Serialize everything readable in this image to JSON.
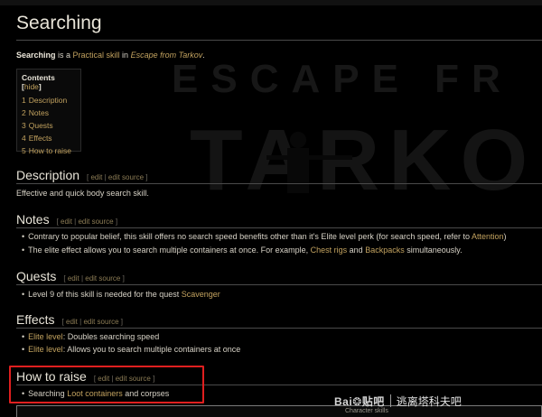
{
  "page": {
    "title": "Searching",
    "intro": {
      "bold": "Searching",
      "t1": " is a ",
      "link1": "Practical skill",
      "t2": " in ",
      "link2": "Escape from Tarkov",
      "t3": "."
    }
  },
  "background_art": {
    "line1": "ESCAPE FR",
    "line2": "TARKO"
  },
  "toc": {
    "title": "Contents",
    "hide_label": "hide",
    "items": [
      {
        "num": "1",
        "label": "Description"
      },
      {
        "num": "2",
        "label": "Notes"
      },
      {
        "num": "3",
        "label": "Quests"
      },
      {
        "num": "4",
        "label": "Effects"
      },
      {
        "num": "5",
        "label": "How to raise"
      }
    ]
  },
  "edit_links": {
    "edit": "edit",
    "edit_source": "edit source"
  },
  "sections": {
    "description": {
      "heading": "Description",
      "text": "Effective and quick body search skill."
    },
    "notes": {
      "heading": "Notes",
      "b1": {
        "t1": "Contrary to popular belief, this skill offers no search speed benefits other than it's Elite level perk (for search speed, refer to ",
        "link": "Attention",
        "t2": ")"
      },
      "b2": {
        "t1": "The elite effect allows you to search multiple containers at once. For example, ",
        "link1": "Chest rigs",
        "t2": " and ",
        "link2": "Backpacks",
        "t3": " simultaneously."
      }
    },
    "quests": {
      "heading": "Quests",
      "b1": {
        "t1": "Level 9 of this skill is needed for the quest ",
        "link": "Scavenger"
      }
    },
    "effects": {
      "heading": "Effects",
      "b1": {
        "link": "Elite level",
        "t1": ": Doubles searching speed"
      },
      "b2": {
        "link": "Elite level",
        "t1": ": Allows you to search multiple containers at once"
      }
    },
    "how_to_raise": {
      "heading": "How to raise",
      "b1": {
        "t1": "Searching ",
        "link": "Loot containers",
        "t2": " and corpses"
      }
    }
  },
  "bottom_caption": "Character skills",
  "watermark": {
    "logo_left": "Bai",
    "logo_right": "贴吧",
    "text": "逃离塔科夫吧"
  },
  "colors": {
    "link": "#c2a25f",
    "highlight": "#e01f1f",
    "background": "#000000"
  }
}
